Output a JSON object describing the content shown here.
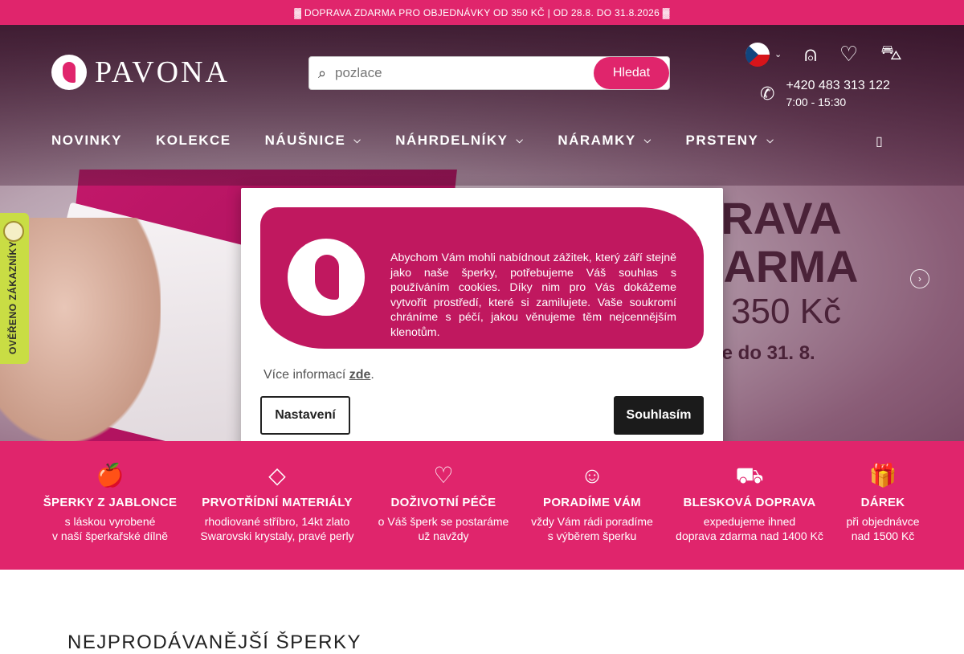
{
  "topbar": {
    "text": "▓ DOPRAVA ZDARMA PRO OBJEDNÁVKY OD 350 KČ | OD 28.8. DO 31.8.2026 ▓"
  },
  "header": {
    "logo_text": "PAVONA",
    "search": {
      "placeholder": "pozlace",
      "button": "Hledat"
    },
    "phone": {
      "number": "+420 483 313 122",
      "hours": "7:00 - 15:30"
    },
    "icons": [
      "flag-cz",
      "user-icon",
      "heart-icon",
      "bag-icon",
      "phone-icon"
    ]
  },
  "nav": {
    "items": [
      {
        "label": "NOVINKY",
        "has_dropdown": false
      },
      {
        "label": "KOLEKCE",
        "has_dropdown": false
      },
      {
        "label": "NÁUŠNICE",
        "has_dropdown": true
      },
      {
        "label": "NÁHRDELNÍKY",
        "has_dropdown": true
      },
      {
        "label": "NÁRAMKY",
        "has_dropdown": true
      },
      {
        "label": "PRSTENY",
        "has_dropdown": true
      }
    ],
    "extra_glyph": "▯"
  },
  "hero": {
    "promo_lines": [
      "PRAVA",
      "DARMA",
      "350 Kč",
      "uze do 31. 8."
    ],
    "box_logo": "PAVONA"
  },
  "badge": {
    "text": "OVĚŘENO ZÁKAZNÍKY"
  },
  "cookie_modal": {
    "text": "Abychom Vám mohli nabídnout zážitek, který září stejně jako naše šperky, potřebujeme Váš souhlas s používáním cookies. Díky nim pro Vás dokážeme vytvořit prostředí, které si zamilujete. Vaše soukromí chráníme s péčí, jakou věnujeme těm nejcennějším klenotům.",
    "more_prefix": "Více informací ",
    "more_link": "zde",
    "more_suffix": ".",
    "settings_button": "Nastavení",
    "accept_button": "Souhlasím"
  },
  "features": [
    {
      "icon": "apple-icon",
      "glyph": "🍎",
      "title": "ŠPERKY Z JABLONCE",
      "line1": "s láskou vyrobené",
      "line2": "v naší šperkařské dílně"
    },
    {
      "icon": "diamond-icon",
      "glyph": "◇",
      "title": "PRVOTŘÍDNÍ MATERIÁLY",
      "line1": "rhodiované stříbro, 14kt zlato",
      "line2": "Swarovski krystaly, pravé perly"
    },
    {
      "icon": "hand-heart-icon",
      "glyph": "♡",
      "title": "DOŽIVOTNÍ PÉČE",
      "line1": "o Váš šperk se postaráme",
      "line2": "už navždy"
    },
    {
      "icon": "advisors-icon",
      "glyph": "☺",
      "title": "PORADÍME VÁM",
      "line1": "vždy Vám rádi poradíme",
      "line2": "s výběrem šperku"
    },
    {
      "icon": "truck-icon",
      "glyph": "⛟",
      "title": "BLESKOVÁ DOPRAVA",
      "line1": "expedujeme ihned",
      "line2": "doprava zdarma nad 1400 Kč"
    },
    {
      "icon": "gift-icon",
      "glyph": "🎁",
      "title": "DÁREK",
      "line1": "při objednávce",
      "line2": "nad 1500 Kč"
    }
  ],
  "section": {
    "title": "NEJPRODÁVANĚJŠÍ ŠPERKY"
  }
}
